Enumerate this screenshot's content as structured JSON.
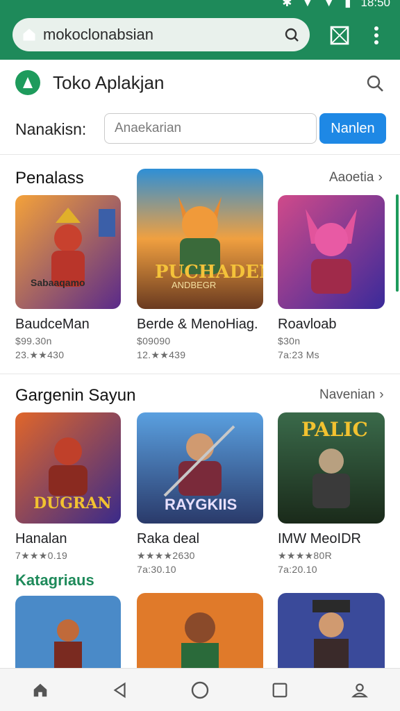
{
  "status": {
    "time": "18:50"
  },
  "browser": {
    "url": "mokoclonabsian"
  },
  "app": {
    "title": "Toko Aplakjan"
  },
  "search": {
    "label": "Nanakisn:",
    "placeholder": "Anaekarian",
    "button": "Nanlen"
  },
  "sections": [
    {
      "title": "Penalass",
      "more": "Aaoetia",
      "cards": [
        {
          "name": "BaudceMan",
          "meta1": "$99.30n",
          "meta2": "23.★★430"
        },
        {
          "name": "Berde & MenoHiag.",
          "meta1": "$09090",
          "meta2": "12.★★439"
        },
        {
          "name": "Roavloab",
          "meta1": "$30n",
          "meta2": "7a:23 Ms"
        }
      ]
    },
    {
      "title": "Gargenin Sayun",
      "more": "Navenian",
      "cards": [
        {
          "name": "Hanalan",
          "meta1": "7★★★0.19",
          "meta2": ""
        },
        {
          "name": "Raka deal",
          "meta1": "★★★★2630",
          "meta2": "7a:30.10"
        },
        {
          "name": "IMW MeoIDR",
          "meta1": "★★★★80R",
          "meta2": "7a:20.10"
        }
      ]
    }
  ],
  "thumb_text": {
    "s1c1": "Sabaaqamo",
    "s1c2_top": "PUCHADEN",
    "s1c2_sub": "ANDBEGR",
    "s2c1": "DUGRAN",
    "s2c2": "RAYGKIIS",
    "s2c3": "PALIC"
  },
  "kategori": {
    "title": "Katagriaus"
  },
  "nav": {
    "items": [
      "home-icon",
      "back-icon",
      "circle-home-icon",
      "recents-icon",
      "profile-icon"
    ]
  },
  "colors": {
    "brand": "#1e8a5a",
    "accent": "#1e88e5"
  }
}
